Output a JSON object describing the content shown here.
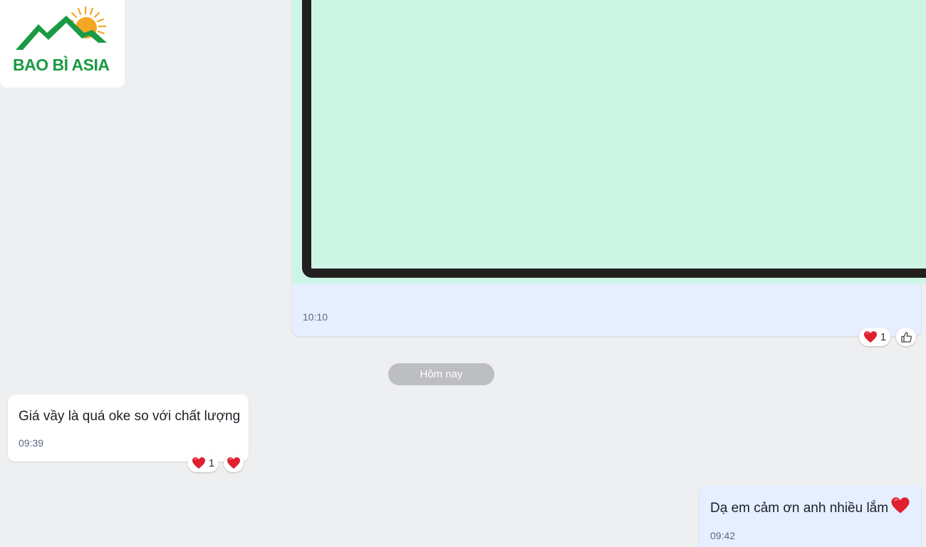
{
  "logo": {
    "text": "BAO BÌ ASIA",
    "colors": {
      "mountain": "#1a9a44",
      "sun": "#f5a623"
    }
  },
  "messages": {
    "image_message": {
      "time": "10:10"
    },
    "image_reactions": {
      "heart_count": "1",
      "icons": [
        "heart-icon",
        "thumbs-up-icon"
      ]
    },
    "date_divider": "Hôm nay",
    "incoming": {
      "text": "Giá vầy là quá oke so với chất lượng",
      "time": "09:39",
      "reaction_count": "1"
    },
    "outgoing": {
      "text": "Dạ em cảm ơn anh nhiều lắm",
      "emoji": "heart-icon",
      "time": "09:42"
    }
  },
  "theme": {
    "background": "#eeeff1",
    "outgoing_bubble": "#e5efff",
    "incoming_bubble": "#ffffff",
    "image_fill": "#ccf5e6",
    "timestamp": "#5a6981"
  }
}
